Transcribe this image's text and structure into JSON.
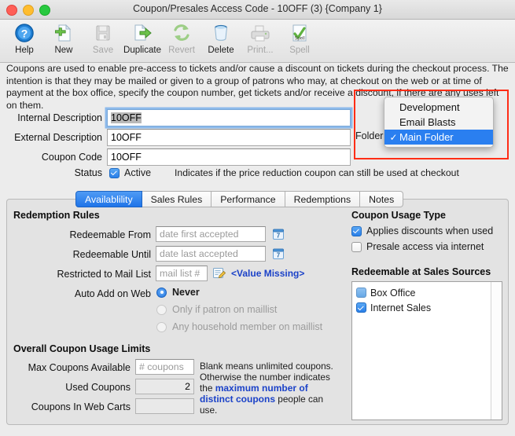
{
  "window": {
    "title": "Coupon/Presales Access Code - 10OFF (3) {Company 1}"
  },
  "toolbar": {
    "buttons": [
      {
        "label": "Help",
        "icon": "help-icon",
        "enabled": true
      },
      {
        "label": "New",
        "icon": "new-document-icon",
        "enabled": true
      },
      {
        "label": "Save",
        "icon": "save-floppy-icon",
        "enabled": false
      },
      {
        "label": "Duplicate",
        "icon": "duplicate-icon",
        "enabled": true
      },
      {
        "label": "Revert",
        "icon": "revert-icon",
        "enabled": false
      },
      {
        "label": "Delete",
        "icon": "trash-icon",
        "enabled": true
      },
      {
        "label": "Print...",
        "icon": "printer-icon",
        "enabled": false
      },
      {
        "label": "Spell",
        "icon": "spell-check-icon",
        "enabled": false
      }
    ]
  },
  "description": "Coupons are used to enable pre-access to tickets and/or cause a discount on tickets during the checkout process.  The intention is that they may be mailed or given to a group of patrons who may, at checkout on the web or at time of payment at the box office, specify the coupon number, get tickets and/or receive a discount, if there are any uses left on them.",
  "fields": {
    "internal_description": {
      "label": "Internal Description",
      "value": "10OFF"
    },
    "external_description": {
      "label": "External Description",
      "value": "10OFF"
    },
    "coupon_code": {
      "label": "Coupon Code",
      "value": "10OFF"
    },
    "status": {
      "label": "Status",
      "checkbox_label": "Active",
      "checked": true,
      "hint": "Indicates if the price reduction coupon can still be used at checkout"
    },
    "folder": {
      "label": "Folder",
      "selected": "Main Folder",
      "options": [
        "Development",
        "Email Blasts",
        "Main Folder"
      ]
    }
  },
  "tabs": [
    {
      "label": "Availablility",
      "active": true
    },
    {
      "label": "Sales Rules",
      "active": false
    },
    {
      "label": "Performance",
      "active": false
    },
    {
      "label": "Redemptions",
      "active": false
    },
    {
      "label": "Notes",
      "active": false
    }
  ],
  "redemption_rules": {
    "heading": "Redemption Rules",
    "redeemable_from": {
      "label": "Redeemable From",
      "placeholder": "date first accepted",
      "value": ""
    },
    "redeemable_until": {
      "label": "Redeemable Until",
      "placeholder": "date last accepted",
      "value": ""
    },
    "restricted_to_mail_list": {
      "label": "Restricted to Mail List",
      "placeholder": "mail list #",
      "value": "",
      "status": "<Value Missing>"
    },
    "auto_add_on_web": {
      "label": "Auto Add on Web",
      "options": [
        {
          "label": "Never",
          "selected": true,
          "enabled": true
        },
        {
          "label": "Only if patron on maillist",
          "selected": false,
          "enabled": false
        },
        {
          "label": "Any household member on maillist",
          "selected": false,
          "enabled": false
        }
      ]
    }
  },
  "usage_limits": {
    "heading": "Overall Coupon Usage Limits",
    "max_coupons_available": {
      "label": "Max Coupons Available",
      "placeholder": "# coupons",
      "value": ""
    },
    "used_coupons": {
      "label": "Used Coupons",
      "value": "2"
    },
    "coupons_in_web_carts": {
      "label": "Coupons In Web Carts",
      "value": ""
    },
    "note_part1": "Blank means unlimited coupons. Otherwise the number indicates the ",
    "note_link": "maximum number of distinct coupons",
    "note_part2": " people can use."
  },
  "coupon_usage_type": {
    "heading": "Coupon Usage Type",
    "options": [
      {
        "label": "Applies discounts when used",
        "checked": true
      },
      {
        "label": "Presale access via internet",
        "checked": false
      }
    ]
  },
  "sales_sources": {
    "heading": "Redeemable at Sales Sources",
    "items": [
      {
        "label": "Box Office",
        "checked": true
      },
      {
        "label": "Internet Sales",
        "checked": true
      }
    ]
  },
  "colors": {
    "accent_blue": "#2a7ff0",
    "annotation_red": "#ff2d16",
    "link_blue": "#1b42c8",
    "window_bg": "#ececec"
  }
}
